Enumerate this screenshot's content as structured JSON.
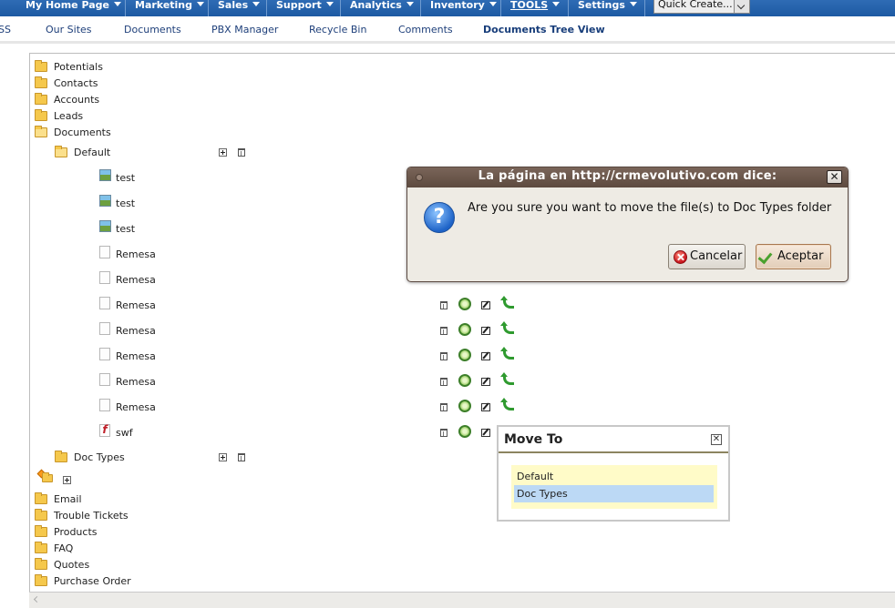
{
  "topnav": {
    "items": [
      {
        "label": "My Home Page"
      },
      {
        "label": "Marketing"
      },
      {
        "label": "Sales"
      },
      {
        "label": "Support"
      },
      {
        "label": "Analytics"
      },
      {
        "label": "Inventory"
      },
      {
        "label": "TOOLS"
      },
      {
        "label": "Settings"
      }
    ],
    "quick_create": "Quick Create..."
  },
  "subnav": {
    "items": [
      {
        "label": "SS"
      },
      {
        "label": "Our Sites"
      },
      {
        "label": "Documents"
      },
      {
        "label": "PBX Manager"
      },
      {
        "label": "Recycle Bin"
      },
      {
        "label": "Comments"
      },
      {
        "label": "Documents Tree View"
      }
    ]
  },
  "tree": {
    "modules_top": [
      "Potentials",
      "Contacts",
      "Accounts",
      "Leads",
      "Documents"
    ],
    "default_folder": "Default",
    "files": [
      {
        "name": "test",
        "type": "image"
      },
      {
        "name": "test",
        "type": "image"
      },
      {
        "name": "test",
        "type": "image"
      },
      {
        "name": "Remesa",
        "type": "doc"
      },
      {
        "name": "Remesa",
        "type": "doc"
      },
      {
        "name": "Remesa",
        "type": "doc"
      },
      {
        "name": "Remesa",
        "type": "doc"
      },
      {
        "name": "Remesa",
        "type": "doc"
      },
      {
        "name": "Remesa",
        "type": "doc"
      },
      {
        "name": "Remesa",
        "type": "doc"
      },
      {
        "name": "swf",
        "type": "flash"
      }
    ],
    "doc_types_folder": "Doc Types",
    "modules_bottom": [
      "Email",
      "Trouble Tickets",
      "Products",
      "FAQ",
      "Quotes",
      "Purchase Order"
    ]
  },
  "dialog": {
    "title": "La página en http://crmevolutivo.com dice:",
    "message": "Are you sure you want to move the file(s) to Doc Types folder",
    "cancel_label": "Cancelar",
    "accept_label": "Aceptar",
    "close_glyph": "✕",
    "icon_glyph": "?"
  },
  "moveto": {
    "title": "Move To",
    "close_glyph": "✕",
    "options": [
      "Default",
      "Doc Types"
    ],
    "selected": "Doc Types"
  },
  "colors": {
    "nav_bg": "#1d5aa3",
    "dialog_title_bg": "#5d4a3f",
    "folder": "#f5c84c",
    "selection": "#bcd9f5",
    "list_bg": "#fffbc8"
  }
}
